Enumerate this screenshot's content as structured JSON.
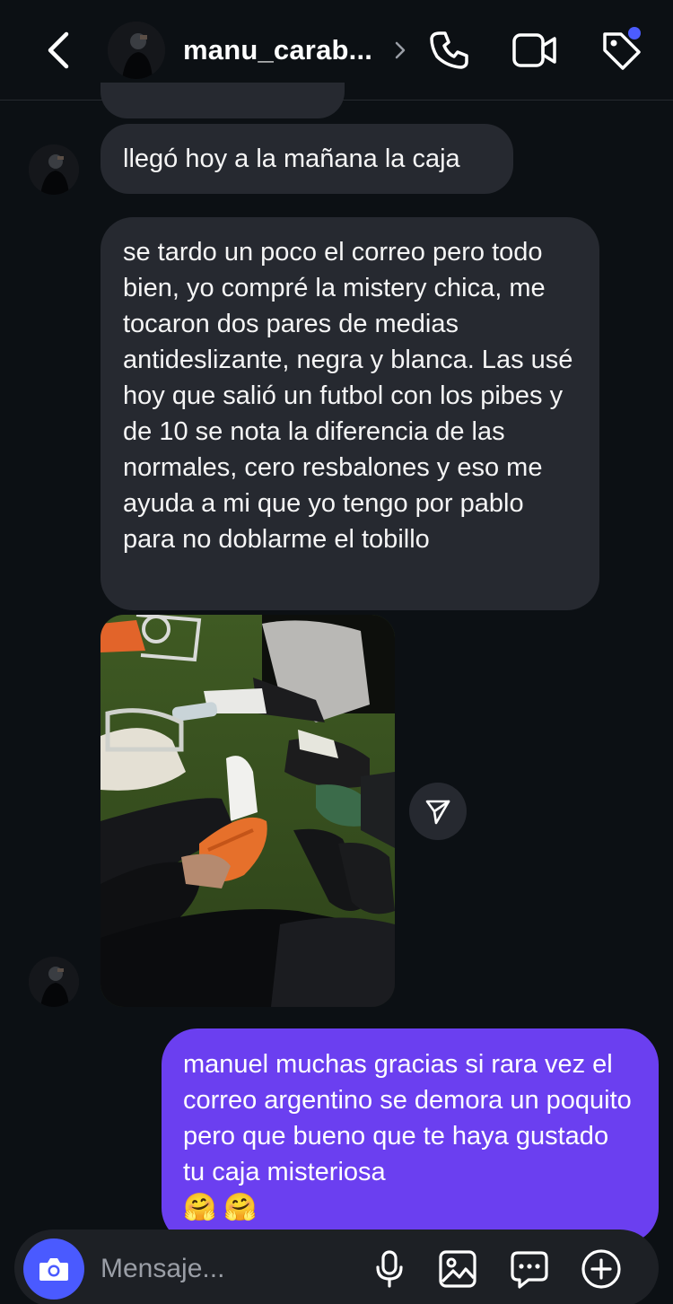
{
  "header": {
    "username": "manu_carab...",
    "has_notification": true
  },
  "icons": {
    "back": "chevron-left-icon",
    "username_chevron": "chevron-right-icon",
    "call": "phone-icon",
    "video": "video-camera-icon",
    "tag": "tag-icon",
    "share": "send-arrow-icon",
    "camera": "camera-icon",
    "mic": "microphone-icon",
    "gallery": "image-icon",
    "sticker": "sticker-icon",
    "plus": "plus-circle-icon"
  },
  "messages": [
    {
      "direction": "received",
      "text": "llegó hoy a la mañana la caja"
    },
    {
      "direction": "received",
      "text": "se tardo un poco el correo pero todo bien, yo compré la mistery chica, me tocaron dos pares de medias antideslizante, negra y blanca. Las usé hoy que salió un futbol con los pibes y de 10 se nota la diferencia de las normales, cero resbalones y  eso me ayuda a mi que yo tengo por pablo para no doblarme el tobillo"
    },
    {
      "direction": "received",
      "type": "photo"
    },
    {
      "direction": "sent",
      "text": "manuel muchas gracias si rara vez el correo argentino se demora un poquito pero que bueno que te haya gustado tu caja misteriosa",
      "emojis": [
        "🤗",
        "🤗"
      ]
    }
  ],
  "composer": {
    "placeholder": "Mensaje..."
  },
  "colors": {
    "background": "#0c1014",
    "received_bubble": "#262930",
    "sent_bubble": "#6b3ff0",
    "camera_button": "#4a5aff",
    "notification_dot": "#4c5cff"
  }
}
